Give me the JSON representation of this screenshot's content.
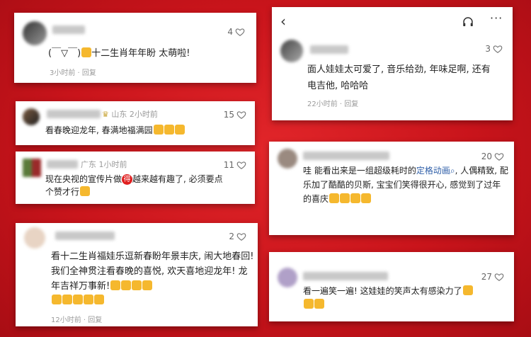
{
  "c1": {
    "likes": "4",
    "text": "(￣▽￣)",
    "text2": "十二生肖年年盼 太萌啦!",
    "meta": "3小时前 · 回复"
  },
  "c2": {
    "location": "山东 2小时前",
    "likes": "15",
    "text": "看春晚迎龙年, 春满地福满园"
  },
  "c3": {
    "location": "广东 1小时前",
    "likes": "11",
    "text1": "现在央视的宣传片做",
    "badge": "得",
    "text2": "越来越有趣了, 必须要点",
    "text3": "个赞才行"
  },
  "c4": {
    "likes": "2",
    "text": "看十二生肖福娃乐逗新春盼年景丰庆, 闹大地春回! 我们全神贯注看春晚的喜悦, 欢天喜地迎龙年! 龙年吉祥万事新!",
    "meta": "12小时前 · 回复"
  },
  "c5": {
    "likes": "3",
    "text": "面人娃娃太可爱了, 音乐给劲, 年味足啊, 还有电吉他, 哈哈哈",
    "meta": "22小时前 · 回复"
  },
  "c6": {
    "likes": "20",
    "text1": "哇 能看出来是一组超级耗时的",
    "link": "定格动画",
    "text2": ", 人偶精致, 配乐加了酷酷的贝斯, 宝宝们笑得很开心, 感觉到了过年的喜庆"
  },
  "c7": {
    "likes": "27",
    "text": "看一遍笑一遍! 这娃娃的笑声太有感染力了"
  },
  "icons": [
    "back-icon",
    "headphones-icon",
    "more-icon",
    "heart-icon",
    "search-icon"
  ]
}
